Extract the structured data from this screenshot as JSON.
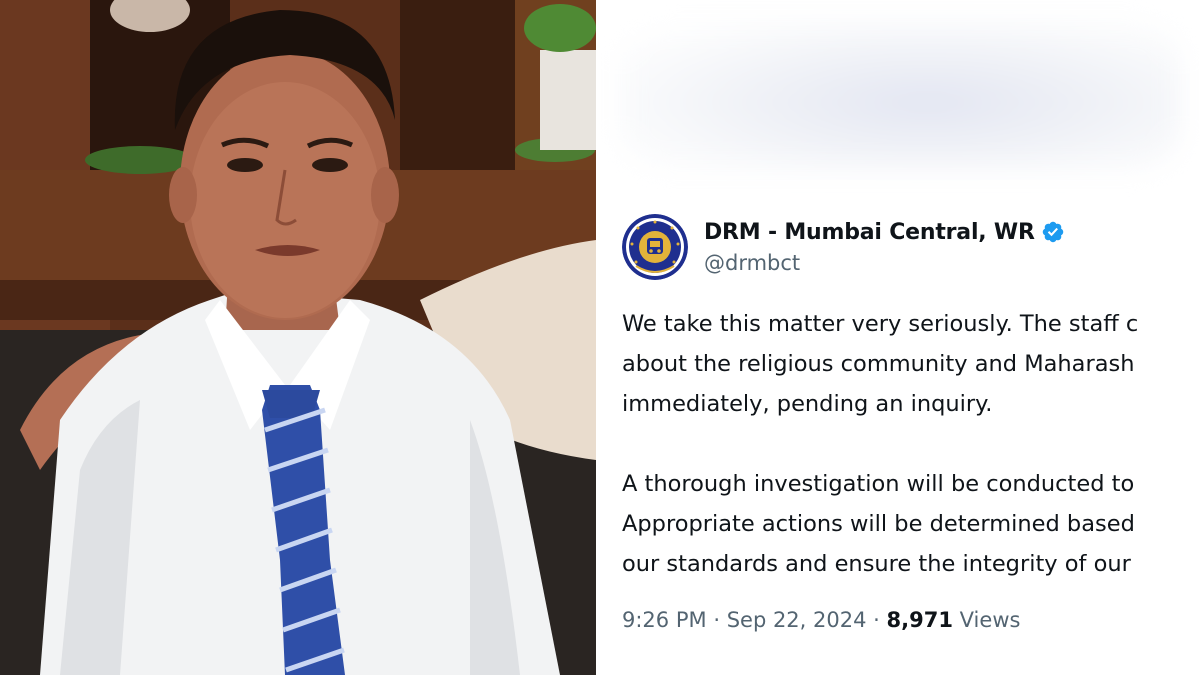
{
  "tweet": {
    "display_name": "DRM - Mumbai Central, WR",
    "handle": "@drmbct",
    "verified_color": "#1d9bf0",
    "lines": [
      "We take this matter very seriously. The staff c",
      "about the religious community and Maharash",
      "immediately, pending an inquiry.",
      "A thorough investigation will be conducted to",
      "Appropriate actions will be determined based",
      "our standards and ensure the integrity of our"
    ],
    "time": "9:26 PM",
    "separator": "·",
    "date": "Sep 22, 2024",
    "views_count": "8,971",
    "views_label": "Views"
  },
  "colors": {
    "text_primary": "#0f1419",
    "text_secondary": "#536471",
    "avatar_blue": "#1f2f8f",
    "avatar_gold": "#e3b33a"
  }
}
